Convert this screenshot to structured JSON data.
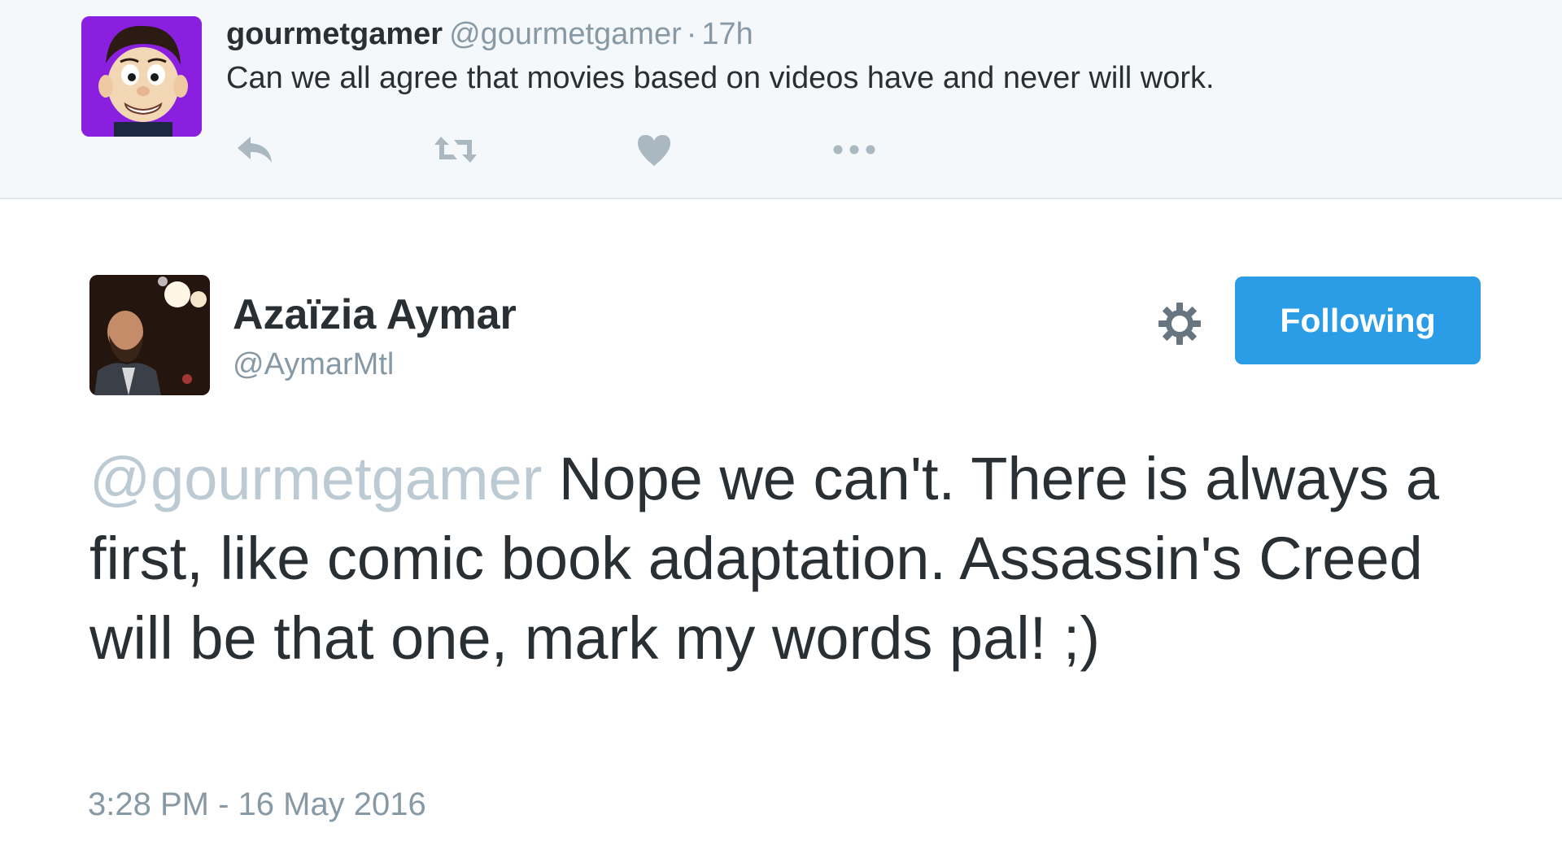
{
  "parent_tweet": {
    "display_name": "gourmetgamer",
    "handle": "@gourmetgamer",
    "separator": "·",
    "time": "17h",
    "text": "Can we all agree that movies based on videos have and never will work.",
    "avatar_icon": "puppet-avatar",
    "avatar_bg": "#8a1fe0",
    "actions": [
      "reply-icon",
      "retweet-icon",
      "like-icon",
      "more-icon"
    ]
  },
  "main_tweet": {
    "display_name": "Azaïzia Aymar",
    "handle": "@AymarMtl",
    "settings_icon": "gear-icon",
    "follow_button": "Following",
    "mention": "@gourmetgamer",
    "text": " Nope we can't. There is always a first, like comic book adaptation. Assassin's Creed will be that one, mark my words pal! ;)",
    "timestamp": "3:28 PM - 16 May 2016"
  },
  "colors": {
    "accent": "#2b9de6",
    "text": "#292f33",
    "muted": "#8899a6",
    "mention": "#bccad4",
    "parent_bg": "#f5f8fa"
  }
}
